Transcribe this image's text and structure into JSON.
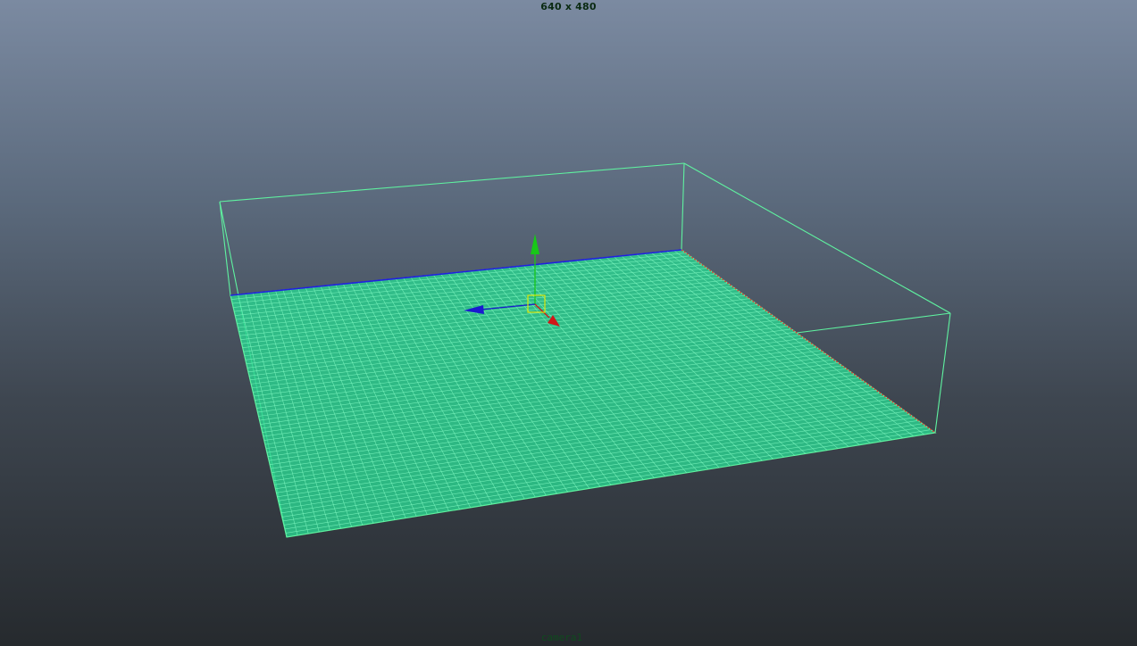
{
  "viewport": {
    "resolution_label": "640 x 480",
    "camera_label": "camera1"
  },
  "scene": {
    "wireframe_color": "#5ff2a0",
    "plane_fill_color": "#2bd390",
    "grid_resolution": 60,
    "manipulator": {
      "type": "move-tool",
      "x_axis_color": "#d01818",
      "y_axis_color": "#18c818",
      "z_axis_color": "#1a1ad0",
      "center_handle_color": "#e8e800"
    }
  },
  "colors": {
    "background_top": "#7b8aa1",
    "background_bottom": "#262a2e",
    "hud_text": "#0a2a12"
  }
}
